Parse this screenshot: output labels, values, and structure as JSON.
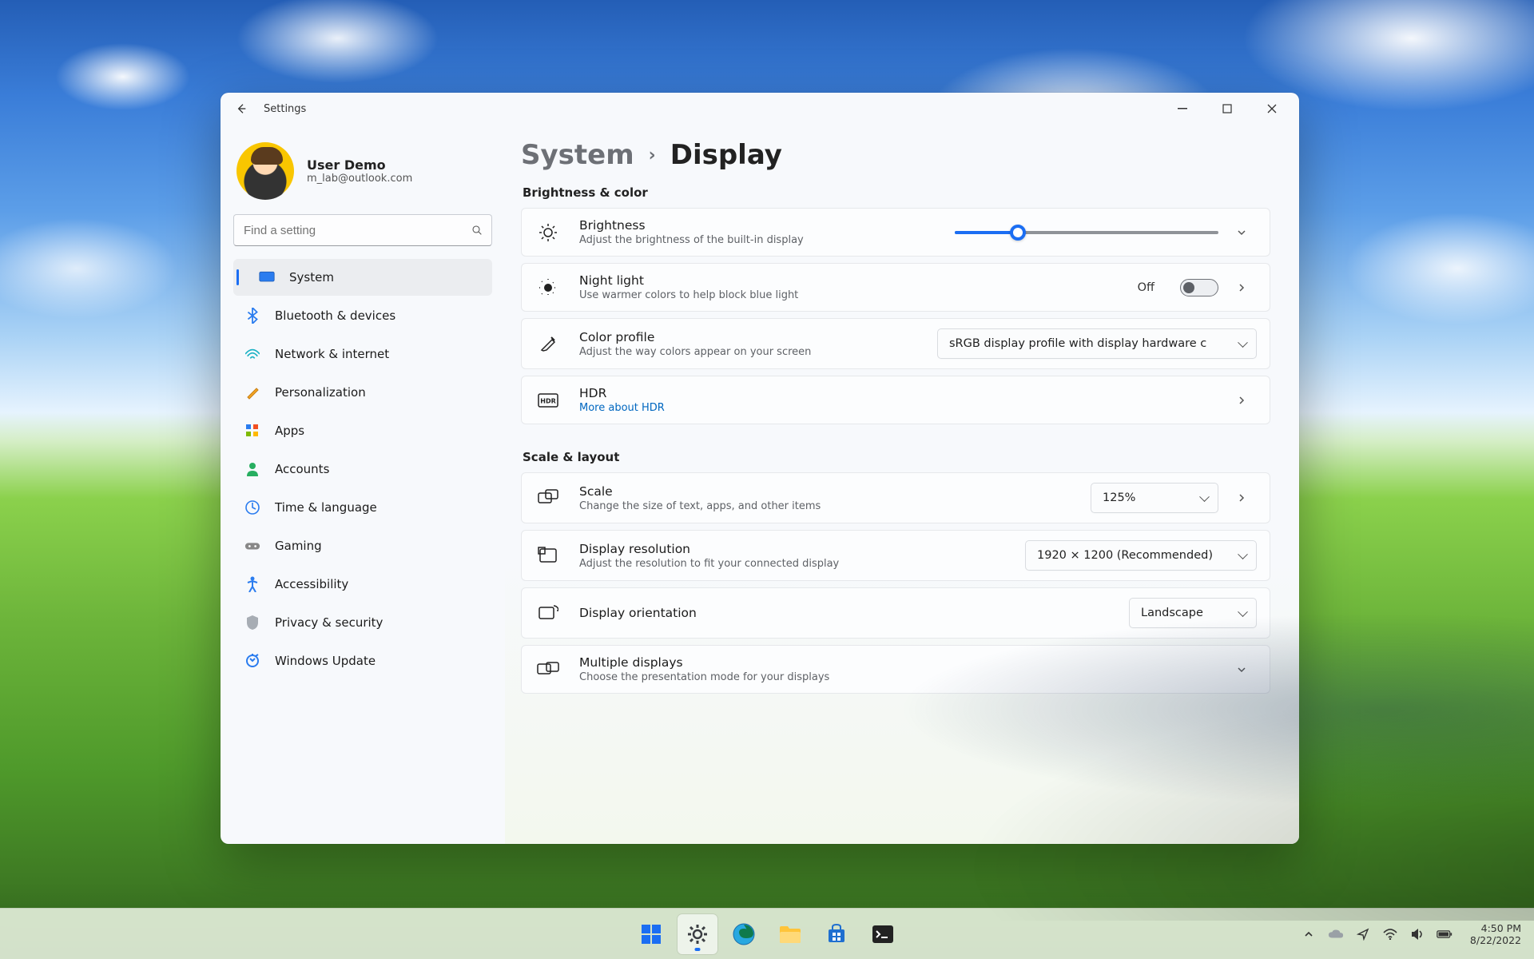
{
  "window": {
    "app_title": "Settings",
    "profile_name": "User Demo",
    "profile_email": "m_lab@outlook.com",
    "search_placeholder": "Find a setting"
  },
  "sidebar": {
    "items": [
      {
        "label": "System"
      },
      {
        "label": "Bluetooth & devices"
      },
      {
        "label": "Network & internet"
      },
      {
        "label": "Personalization"
      },
      {
        "label": "Apps"
      },
      {
        "label": "Accounts"
      },
      {
        "label": "Time & language"
      },
      {
        "label": "Gaming"
      },
      {
        "label": "Accessibility"
      },
      {
        "label": "Privacy & security"
      },
      {
        "label": "Windows Update"
      }
    ],
    "active_index": 0
  },
  "breadcrumb": {
    "parent": "System",
    "current": "Display"
  },
  "sections": {
    "brightness_color": {
      "label": "Brightness & color",
      "brightness": {
        "title": "Brightness",
        "subtitle": "Adjust the brightness of the built-in display",
        "value_percent": 24
      },
      "night_light": {
        "title": "Night light",
        "subtitle": "Use warmer colors to help block blue light",
        "state_text": "Off",
        "on": false
      },
      "color_profile": {
        "title": "Color profile",
        "subtitle": "Adjust the way colors appear on your screen",
        "selected": "sRGB display profile with display hardware c"
      },
      "hdr": {
        "title": "HDR",
        "subtitle_link": "More about HDR"
      }
    },
    "scale_layout": {
      "label": "Scale & layout",
      "scale": {
        "title": "Scale",
        "subtitle": "Change the size of text, apps, and other items",
        "selected": "125%"
      },
      "resolution": {
        "title": "Display resolution",
        "subtitle": "Adjust the resolution to fit your connected display",
        "selected": "1920 × 1200 (Recommended)"
      },
      "orientation": {
        "title": "Display orientation",
        "selected": "Landscape"
      },
      "multi_display": {
        "title": "Multiple displays",
        "subtitle": "Choose the presentation mode for your displays"
      }
    }
  },
  "taskbar": {
    "time": "4:50 PM",
    "date": "8/22/2022"
  },
  "colors": {
    "accent": "#1B6EF3"
  }
}
